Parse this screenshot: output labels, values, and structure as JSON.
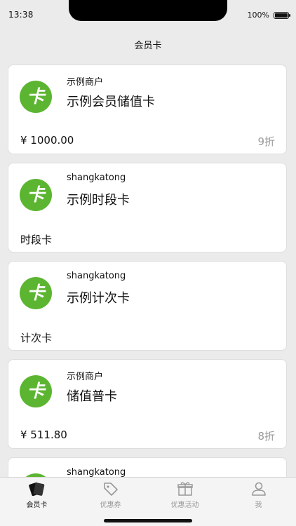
{
  "status": {
    "time": "13:38",
    "battery": "100%"
  },
  "nav": {
    "title": "会员卡"
  },
  "colors": {
    "brand_green": "#5cb531",
    "background": "#ebebeb"
  },
  "cards": [
    {
      "merchant": "示例商户",
      "name": "示例会员储值卡",
      "balance": "¥ 1000.00",
      "discount": "9折"
    },
    {
      "merchant": "shangkatong",
      "name": "示例时段卡",
      "type_label": "时段卡"
    },
    {
      "merchant": "shangkatong",
      "name": "示例计次卡",
      "type_label": "计次卡"
    },
    {
      "merchant": "示例商户",
      "name": "储值普卡",
      "balance": "¥ 511.80",
      "discount": "8折"
    },
    {
      "merchant": "shangkatong"
    }
  ],
  "card_logo_icon": "green-card-logo-icon",
  "tabs": [
    {
      "label": "会员卡",
      "icon": "member-card-icon",
      "active": true
    },
    {
      "label": "优惠券",
      "icon": "coupon-tag-icon",
      "active": false
    },
    {
      "label": "优惠活动",
      "icon": "gift-icon",
      "active": false
    },
    {
      "label": "我",
      "icon": "person-icon",
      "active": false
    }
  ]
}
